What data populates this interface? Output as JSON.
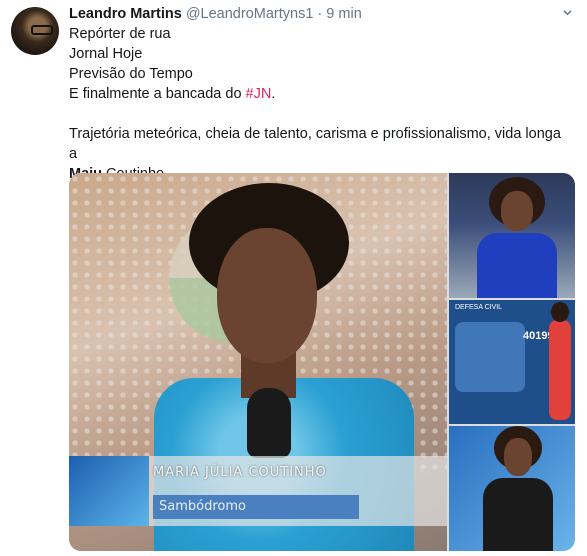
{
  "tweet": {
    "author_name": "Leandro Martins",
    "handle": "@LeandroMartyns1",
    "separator": "·",
    "time": "9 min",
    "lines": [
      "Repórter de rua",
      "Jornal Hoje",
      "Previsão do Tempo"
    ],
    "line4_prefix": "E finalmente a bancada do ",
    "hashtag": "#JN",
    "line4_suffix": ".",
    "para2": "Trajetória meteórica, cheia de talento, carisma e profissionalismo, vida longa a",
    "name_bold": "Maju",
    "name_rest": " Coutinho."
  },
  "media": {
    "main_caption_name": "MARIA JÚLIA COUTINHO",
    "main_caption_place": "Sambódromo",
    "side2_header": "DEFESA CIVIL",
    "side2_number": "40199"
  },
  "icons": {
    "more": "chevron-down-icon"
  },
  "colors": {
    "hashtag": "#e0245e",
    "secondary_text": "#657786"
  }
}
